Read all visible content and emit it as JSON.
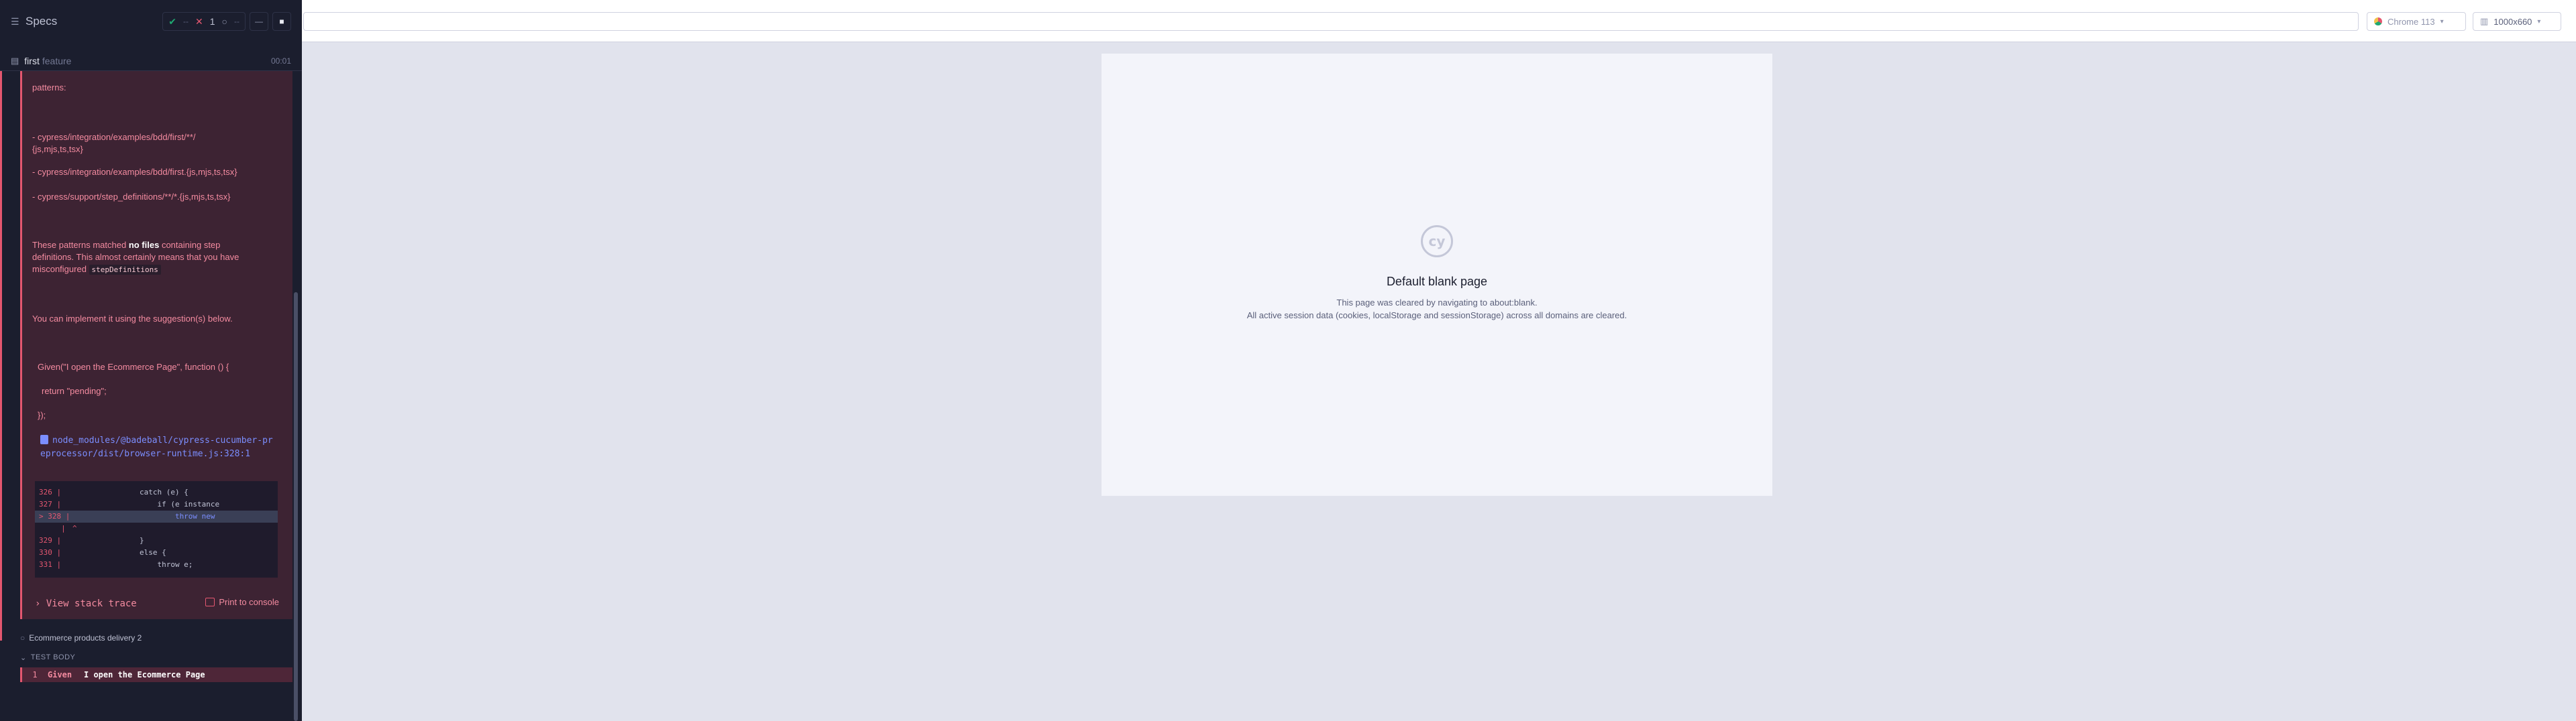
{
  "reporter": {
    "title": "Specs",
    "stats": {
      "passed": "--",
      "failed": "1",
      "pending": "--"
    },
    "spec": {
      "name": "first",
      "ext": "feature",
      "duration": "00:01"
    }
  },
  "error": {
    "patterns_label": "patterns:",
    "pattern1a": "- cypress/integration/examples/bdd/first/**/",
    "pattern1b": "{js,mjs,ts,tsx}",
    "pattern2": "- cypress/integration/examples/bdd/first.{js,mjs,ts,tsx}",
    "pattern3": "- cypress/support/step_definitions/**/*.{js,mjs,ts,tsx}",
    "matched_pre": "These patterns matched ",
    "matched_bold": "no files",
    "matched_post": " containing step",
    "matched_line2": "definitions. This almost certainly means that you have",
    "matched_line3_pre": "misconfigured ",
    "matched_chip": "stepDefinitions",
    "suggestion": "You can implement it using the suggestion(s) below.",
    "code1": "Given(\"I open the Ecommerce Page\", function () {",
    "code2": "return \"pending\";",
    "code3": "});",
    "file_link": "node_modules/@badeball/cypress-cucumber-preprocessor/dist/browser-runtime.js:328:1",
    "code_lines": [
      {
        "ln": "326 |",
        "src": "                catch (e) {"
      },
      {
        "ln": "327 |",
        "src": "                    if (e instance"
      },
      {
        "ln": "> 328 |",
        "src": "                        throw new"
      },
      {
        "ln": "     |",
        "src": "^"
      },
      {
        "ln": "329 |",
        "src": "                }"
      },
      {
        "ln": "330 |",
        "src": "                else {"
      },
      {
        "ln": "331 |",
        "src": "                    throw e;"
      }
    ],
    "view_stack": "View stack trace",
    "print_console": "Print to console"
  },
  "next_test": "Ecommerce products delivery 2",
  "test_body": "TEST BODY",
  "command": {
    "num": "1",
    "name": "Given",
    "message": "I open the Ecommerce Page"
  },
  "browser": {
    "name": "Chrome 113",
    "viewport": "1000x660"
  },
  "blank_page": {
    "logo_text": "cy",
    "title": "Default blank page",
    "line1": "This page was cleared by navigating to about:blank.",
    "line2": "All active session data (cookies, localStorage and sessionStorage) across all domains are cleared."
  },
  "colors": {
    "fail": "#e45770",
    "pass": "#1fa971",
    "link": "#7b8eff",
    "panel": "#1b1e2e"
  }
}
